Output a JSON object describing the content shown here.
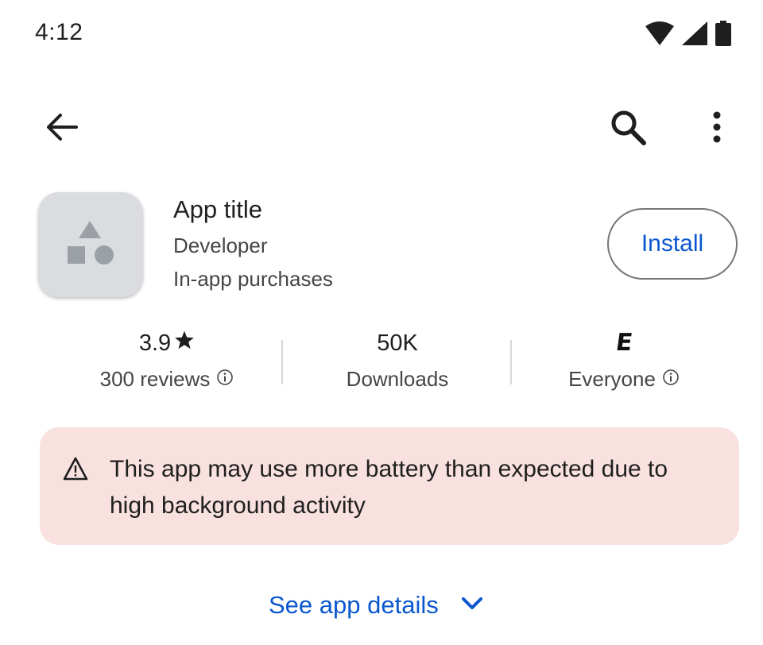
{
  "status_bar": {
    "time": "4:12",
    "icons": [
      "wifi-icon",
      "cellular-signal-icon",
      "battery-icon"
    ]
  },
  "top_bar": {
    "icons": [
      "back-arrow-icon",
      "search-icon",
      "more-vert-icon"
    ]
  },
  "app": {
    "title": "App title",
    "developer": "Developer",
    "in_app_purchases": "In-app purchases",
    "icon": "app-placeholder-shapes-icon",
    "install_label": "Install"
  },
  "stats": {
    "rating": {
      "value": "3.9",
      "label": "300 reviews"
    },
    "downloads": {
      "value": "50K",
      "label": "Downloads"
    },
    "content_rating": {
      "badge": "E",
      "label": "Everyone"
    }
  },
  "warning": {
    "text": "This app may use more battery than expected due to high background activity",
    "icon": "warning-triangle-icon"
  },
  "details": {
    "label": "See app details",
    "icon": "chevron-down-icon"
  },
  "colors": {
    "accent": "#0b57d0",
    "warning_bg": "#f8e1df",
    "icon_bg": "#dadcdf",
    "icon_shape": "#9aa0a6"
  }
}
